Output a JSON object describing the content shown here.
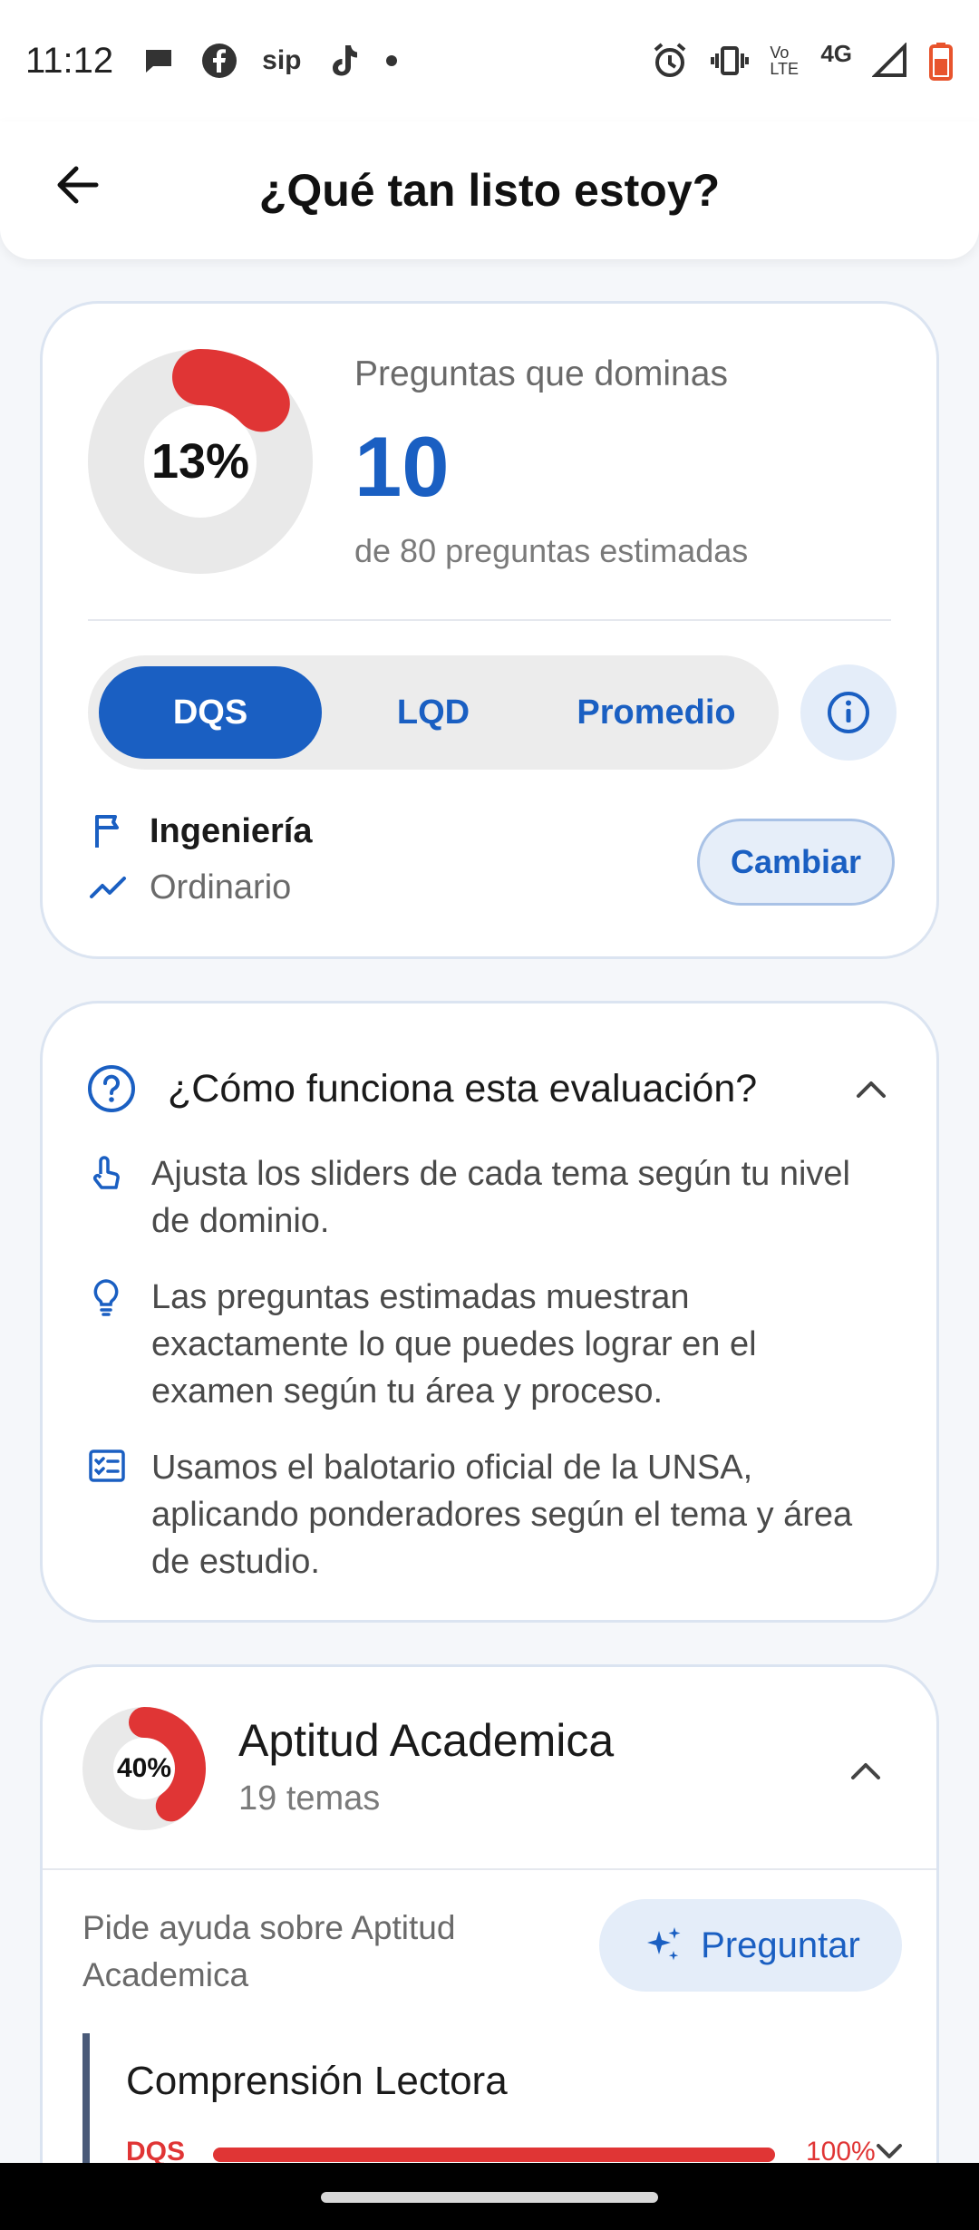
{
  "status_bar": {
    "time": "11:12",
    "net_label": "4G",
    "volte_label": "Vo LTE",
    "sip_label": "sip"
  },
  "header": {
    "title": "¿Qué tan listo estoy?"
  },
  "summary": {
    "percent_label": "13%",
    "percent_value": 0.13,
    "label": "Preguntas que dominas",
    "value": "10",
    "subtitle": "de 80 preguntas estimadas",
    "tabs": [
      "DQS",
      "LQD",
      "Promedio"
    ],
    "active_tab": "DQS",
    "area": "Ingeniería",
    "process": "Ordinario",
    "change_label": "Cambiar"
  },
  "how": {
    "title": "¿Cómo funciona esta evaluación?",
    "items": [
      "Ajusta los sliders de cada tema según tu nivel de dominio.",
      "Las preguntas estimadas muestran exactamente lo que puedes lograr en el examen según tu área y proceso.",
      "Usamos el balotario oficial de la UNSA, aplicando ponderadores según el tema y área de estudio."
    ]
  },
  "section": {
    "percent_label": "40%",
    "percent_value": 0.4,
    "title": "Aptitud Academica",
    "subtitle": "19 temas",
    "help_text": "Pide ayuda sobre Aptitud Academica",
    "ask_label": "Preguntar",
    "topic": {
      "name": "Comprensión Lectora",
      "bar_label": "DQS",
      "bar_value_label": "100%",
      "bar_value": 1.0
    }
  },
  "colors": {
    "primary": "#1a5fc2",
    "danger": "#e03535",
    "donut_track": "#e9e9e9"
  }
}
